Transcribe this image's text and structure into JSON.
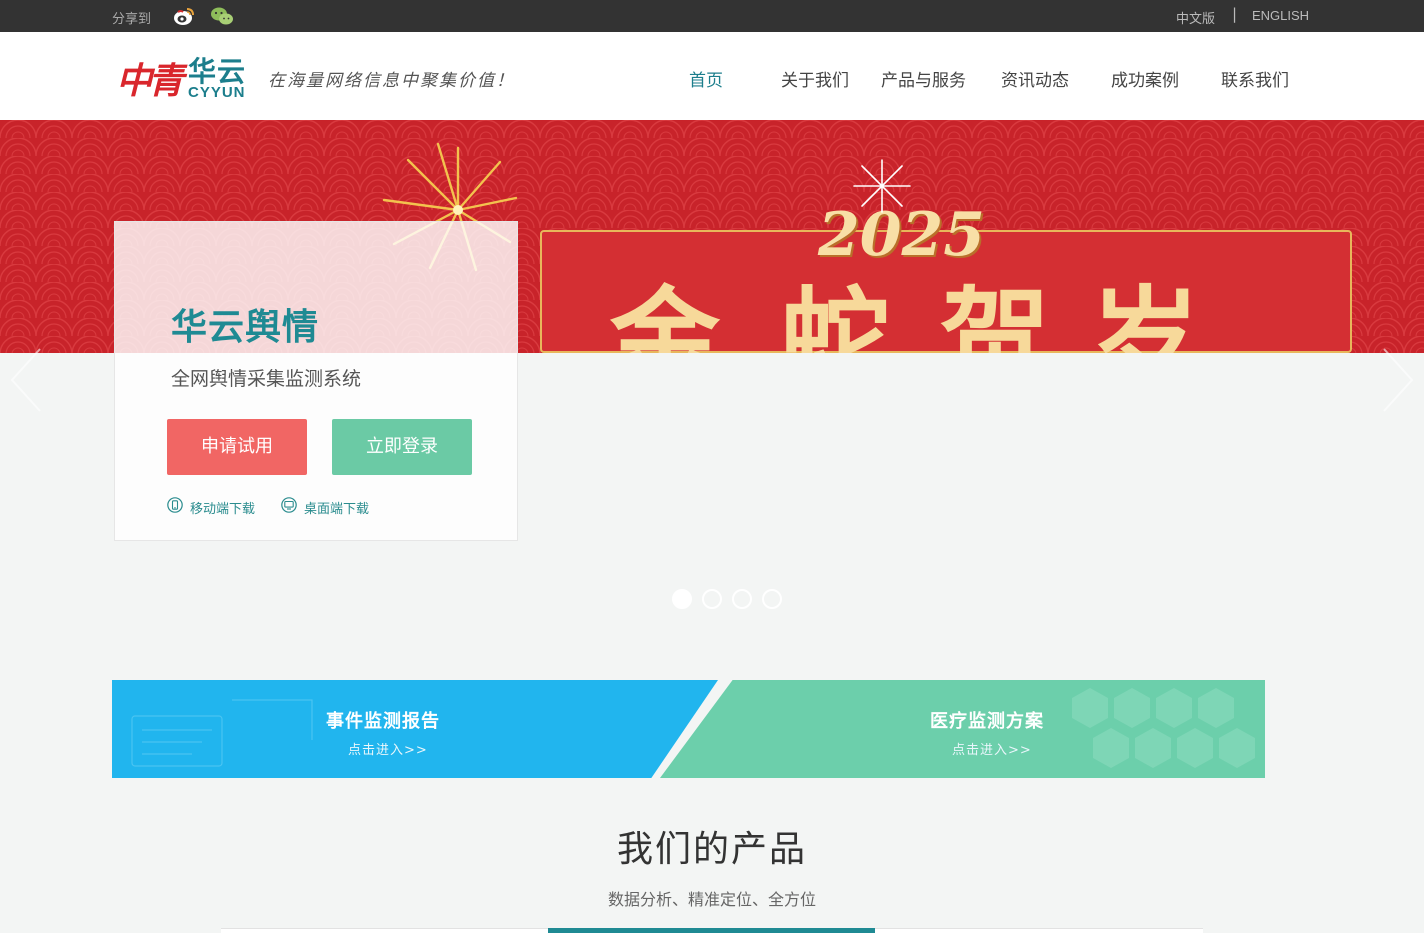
{
  "topbar": {
    "share_label": "分享到",
    "share_icons": [
      "weibo-icon",
      "wechat-icon"
    ],
    "lang_cn": "中文版",
    "lang_sep": "|",
    "lang_en": "ENGLISH"
  },
  "header": {
    "logo_mark": "中青",
    "logo_cn": "华云",
    "logo_en": "CYYUN",
    "slogan": "在海量网络信息中聚集价值！",
    "nav": [
      "首页",
      "关于我们",
      "产品与服务",
      "资讯动态",
      "成功案例",
      "联系我们"
    ],
    "active_nav": "首页"
  },
  "hero": {
    "year": "2025",
    "chars": [
      "金",
      "蛇",
      "贺",
      "岁"
    ]
  },
  "card": {
    "title": "华云舆情",
    "subtitle": "全网舆情采集监测系统",
    "btn_trial": "申请试用",
    "btn_login": "立即登录",
    "dl_mobile": "移动端下载",
    "dl_desktop": "桌面端下载"
  },
  "carousel": {
    "total": 4,
    "active": 1
  },
  "banners": {
    "left_title": "事件监测报告",
    "left_link": "点击进入>>",
    "right_title": "医疗监测方案",
    "right_link": "点击进入>>"
  },
  "products": {
    "title": "我们的产品",
    "subtitle": "数据分析、精准定位、全方位"
  },
  "colors": {
    "accent": "#1f8a93",
    "trial_red": "#f16664",
    "login_green": "#6bcaa5",
    "banner_blue": "#21b5ee",
    "banner_green": "#6ccfab",
    "hero_red": "#c8232a"
  }
}
